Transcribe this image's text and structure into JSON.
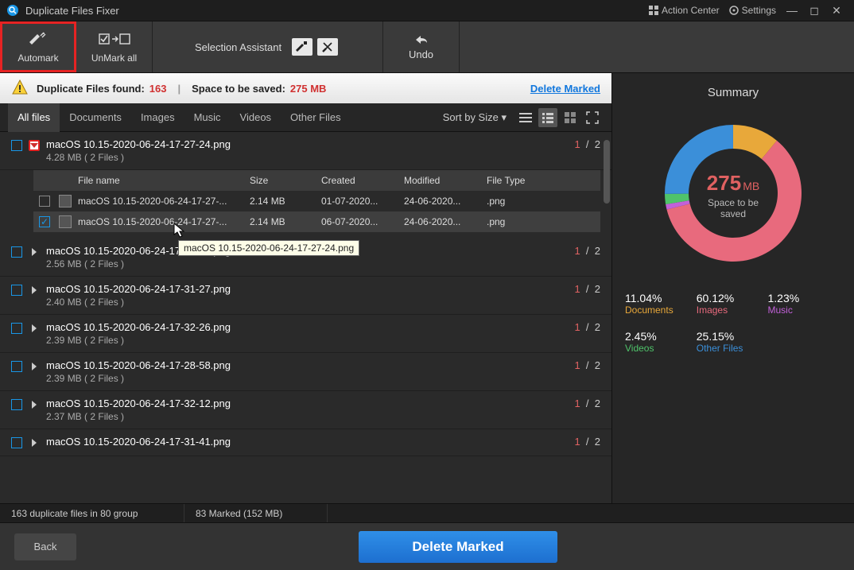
{
  "app": {
    "title": "Duplicate Files Fixer"
  },
  "titlebar": {
    "actionCenter": "Action Center",
    "settings": "Settings"
  },
  "toolbar": {
    "automark": "Automark",
    "unmark": "UnMark all",
    "selectionAssistant": "Selection Assistant",
    "undo": "Undo"
  },
  "info": {
    "foundLabel": "Duplicate Files found:",
    "foundCount": "163",
    "spaceLabel": "Space to be saved:",
    "spaceValue": "275 MB",
    "deleteMarked": "Delete Marked"
  },
  "tabs": [
    "All files",
    "Documents",
    "Images",
    "Music",
    "Videos",
    "Other Files"
  ],
  "sortBy": "Sort by Size",
  "tableHead": {
    "fileName": "File name",
    "size": "Size",
    "created": "Created",
    "modified": "Modified",
    "fileType": "File Type"
  },
  "groups": [
    {
      "name": "macOS 10.15-2020-06-24-17-27-24.png",
      "meta": "4.28 MB  ( 2 Files )",
      "marked": "1",
      "total": "2",
      "expanded": true,
      "files": [
        {
          "checked": false,
          "name": "macOS 10.15-2020-06-24-17-27-...",
          "size": "2.14 MB",
          "created": "01-07-2020...",
          "modified": "24-06-2020...",
          "type": ".png"
        },
        {
          "checked": true,
          "name": "macOS 10.15-2020-06-24-17-27-...",
          "size": "2.14 MB",
          "created": "06-07-2020...",
          "modified": "24-06-2020...",
          "type": ".png"
        }
      ]
    },
    {
      "name": "macOS 10.15-2020-06-24-17-33-36.png",
      "meta": "2.56 MB  ( 2 Files )",
      "marked": "1",
      "total": "2",
      "expanded": false
    },
    {
      "name": "macOS 10.15-2020-06-24-17-31-27.png",
      "meta": "2.40 MB  ( 2 Files )",
      "marked": "1",
      "total": "2",
      "expanded": false
    },
    {
      "name": "macOS 10.15-2020-06-24-17-32-26.png",
      "meta": "2.39 MB  ( 2 Files )",
      "marked": "1",
      "total": "2",
      "expanded": false
    },
    {
      "name": "macOS 10.15-2020-06-24-17-28-58.png",
      "meta": "2.39 MB  ( 2 Files )",
      "marked": "1",
      "total": "2",
      "expanded": false
    },
    {
      "name": "macOS 10.15-2020-06-24-17-32-12.png",
      "meta": "2.37 MB  ( 2 Files )",
      "marked": "1",
      "total": "2",
      "expanded": false
    },
    {
      "name": "macOS 10.15-2020-06-24-17-31-41.png",
      "meta": "",
      "marked": "1",
      "total": "2",
      "expanded": false
    }
  ],
  "tooltip": "macOS 10.15-2020-06-24-17-27-24.png",
  "summary": {
    "title": "Summary",
    "centerValue": "275",
    "centerUnit": "MB",
    "centerSub": "Space to be\nsaved",
    "cats": [
      {
        "pct": "11.04%",
        "label": "Documents",
        "color": "#e8a83a"
      },
      {
        "pct": "60.12%",
        "label": "Images",
        "color": "#e86a7d"
      },
      {
        "pct": "1.23%",
        "label": "Music",
        "color": "#c261d9"
      },
      {
        "pct": "2.45%",
        "label": "Videos",
        "color": "#4fc36a"
      },
      {
        "pct": "25.15%",
        "label": "Other Files",
        "color": "#3b8fd9"
      }
    ]
  },
  "chart_data": {
    "type": "pie",
    "title": "Space to be saved",
    "series": [
      {
        "name": "Documents",
        "value": 11.04,
        "color": "#e8a83a"
      },
      {
        "name": "Images",
        "value": 60.12,
        "color": "#e86a7d"
      },
      {
        "name": "Music",
        "value": 1.23,
        "color": "#c261d9"
      },
      {
        "name": "Videos",
        "value": 2.45,
        "color": "#4fc36a"
      },
      {
        "name": "Other Files",
        "value": 25.15,
        "color": "#3b8fd9"
      }
    ]
  },
  "status": {
    "left": "163 duplicate files in 80 group",
    "right": "83 Marked (152 MB)"
  },
  "bottom": {
    "back": "Back",
    "delete": "Delete Marked"
  }
}
